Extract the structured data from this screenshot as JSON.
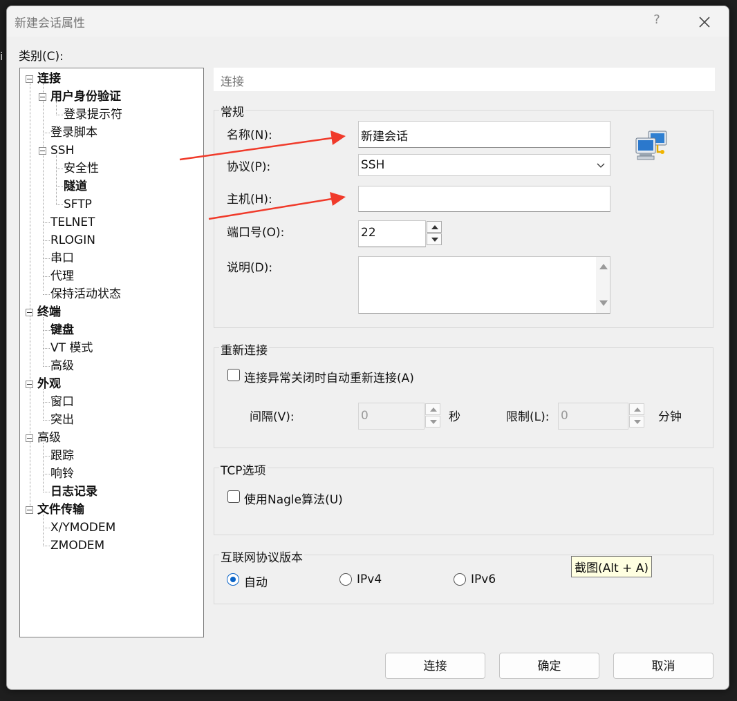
{
  "window": {
    "title": "新建会话属性",
    "help_glyph": "?"
  },
  "category_label": "类别(C):",
  "tree": [
    {
      "label": "连接",
      "bold": true
    },
    {
      "label": "用户身份验证",
      "bold": true
    },
    {
      "label": "登录提示符",
      "bold": false
    },
    {
      "label": "登录脚本",
      "bold": false
    },
    {
      "label": "SSH",
      "bold": false
    },
    {
      "label": "安全性",
      "bold": false
    },
    {
      "label": "隧道",
      "bold": true
    },
    {
      "label": "SFTP",
      "bold": false
    },
    {
      "label": "TELNET",
      "bold": false
    },
    {
      "label": "RLOGIN",
      "bold": false
    },
    {
      "label": "串口",
      "bold": false
    },
    {
      "label": "代理",
      "bold": false
    },
    {
      "label": "保持活动状态",
      "bold": false
    },
    {
      "label": "终端",
      "bold": true
    },
    {
      "label": "键盘",
      "bold": true
    },
    {
      "label": "VT 模式",
      "bold": false
    },
    {
      "label": "高级",
      "bold": false
    },
    {
      "label": "外观",
      "bold": true
    },
    {
      "label": "窗口",
      "bold": false
    },
    {
      "label": "突出",
      "bold": false
    },
    {
      "label": "高级",
      "bold": false
    },
    {
      "label": "跟踪",
      "bold": false
    },
    {
      "label": "响铃",
      "bold": false
    },
    {
      "label": "日志记录",
      "bold": true
    },
    {
      "label": "文件传输",
      "bold": true
    },
    {
      "label": "X/YMODEM",
      "bold": false
    },
    {
      "label": "ZMODEM",
      "bold": false
    }
  ],
  "page_header": "连接",
  "general": {
    "group_label": "常规",
    "name_label": "名称(N):",
    "name_value": "新建会话",
    "protocol_label": "协议(P):",
    "protocol_value": "SSH",
    "host_label": "主机(H):",
    "host_value": "",
    "port_label": "端口号(O):",
    "port_value": "22",
    "desc_label": "说明(D):",
    "desc_value": "",
    "icon": "network-computers-icon"
  },
  "reconnect": {
    "group_label": "重新连接",
    "checkbox_label": "连接异常关闭时自动重新连接(A)",
    "checked": false,
    "interval_label": "间隔(V):",
    "interval_value": "0",
    "interval_unit": "秒",
    "limit_label": "限制(L):",
    "limit_value": "0",
    "limit_unit": "分钟"
  },
  "tcp": {
    "group_label": "TCP选项",
    "nagle_label": "使用Nagle算法(U)",
    "checked": false
  },
  "ip_version": {
    "group_label": "互联网协议版本",
    "options": [
      "自动",
      "IPv4",
      "IPv6"
    ],
    "selected": "自动"
  },
  "tooltip": "截图(Alt + A)",
  "buttons": {
    "connect": "连接",
    "ok": "确定",
    "cancel": "取消"
  },
  "colors": {
    "arrow": "#f03a2a",
    "radio_accent": "#0a64c8"
  }
}
